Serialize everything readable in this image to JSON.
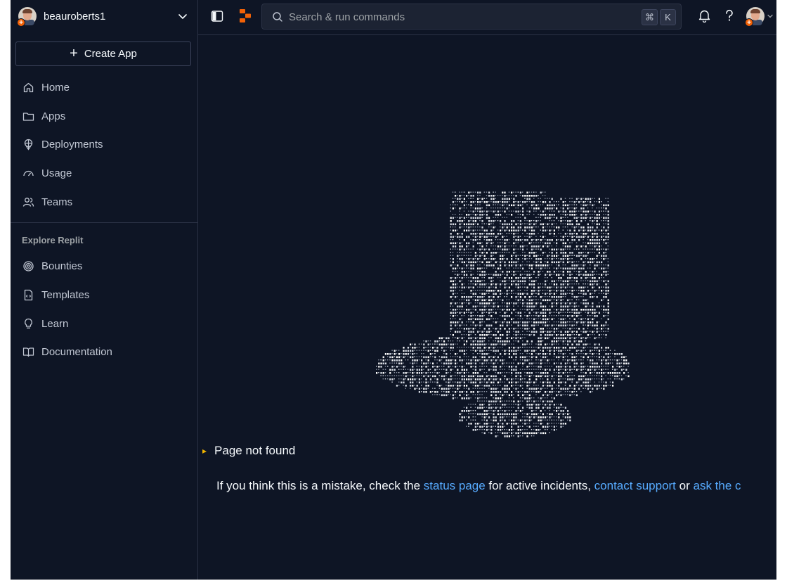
{
  "account": {
    "username": "beauroberts1"
  },
  "create_app": {
    "label": "Create App"
  },
  "nav": {
    "home": "Home",
    "apps": "Apps",
    "deployments": "Deployments",
    "usage": "Usage",
    "teams": "Teams"
  },
  "explore": {
    "label": "Explore Replit",
    "bounties": "Bounties",
    "templates": "Templates",
    "learn": "Learn",
    "documentation": "Documentation"
  },
  "topbar": {
    "search_placeholder": "Search & run commands",
    "shortcut_key_1": "⌘",
    "shortcut_key_2": "K"
  },
  "error": {
    "title": "Page not found",
    "message_prefix": "If you think this is a mistake, check the ",
    "status_link": "status page",
    "message_mid": " for active incidents, ",
    "support_link": "contact support",
    "message_or": " or ",
    "ask_link": "ask the c"
  },
  "colors": {
    "background": "#0e1525",
    "accent": "#f26207",
    "link": "#57abff"
  }
}
